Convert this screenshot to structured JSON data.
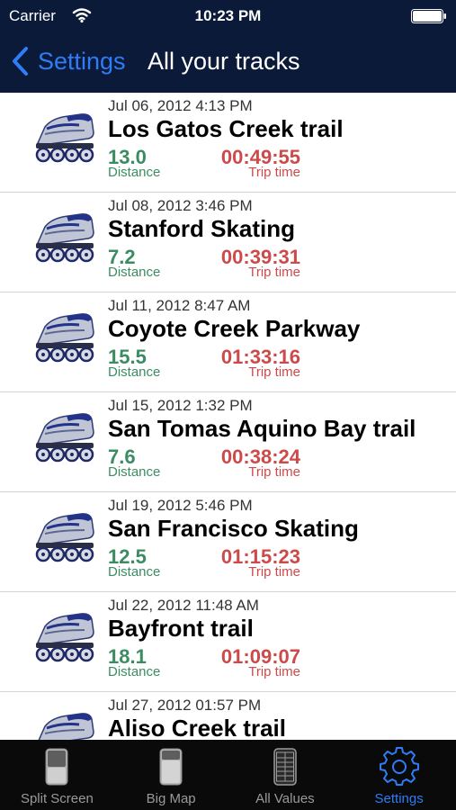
{
  "status_bar": {
    "carrier": "Carrier",
    "time": "10:23 PM"
  },
  "nav": {
    "back_label": "Settings",
    "title": "All your tracks"
  },
  "colors": {
    "nav_background": "#0b1a38",
    "accent": "#2f7cf6",
    "distance": "#3c8c62",
    "trip_time": "#cc4a4a",
    "tab_inactive": "#9a9a9a"
  },
  "tracks": [
    {
      "date": "Jul 06, 2012 4:13 PM",
      "name": "Los Gatos Creek trail",
      "distance": "13.0",
      "distance_label": "Distance",
      "trip_time": "00:49:55",
      "trip_time_label": "Trip time",
      "icon": "inline-skate-icon"
    },
    {
      "date": "Jul 08, 2012 3:46 PM",
      "name": "Stanford Skating",
      "distance": "7.2",
      "distance_label": "Distance",
      "trip_time": "00:39:31",
      "trip_time_label": "Trip time",
      "icon": "inline-skate-icon"
    },
    {
      "date": "Jul 11, 2012 8:47 AM",
      "name": "Coyote Creek Parkway",
      "distance": "15.5",
      "distance_label": "Distance",
      "trip_time": "01:33:16",
      "trip_time_label": "Trip time",
      "icon": "inline-skate-icon"
    },
    {
      "date": "Jul 15, 2012 1:32 PM",
      "name": "San Tomas Aquino Bay trail",
      "distance": "7.6",
      "distance_label": "Distance",
      "trip_time": "00:38:24",
      "trip_time_label": "Trip time",
      "icon": "inline-skate-icon"
    },
    {
      "date": "Jul 19, 2012 5:46 PM",
      "name": "San Francisco Skating",
      "distance": "12.5",
      "distance_label": "Distance",
      "trip_time": "01:15:23",
      "trip_time_label": "Trip time",
      "icon": "inline-skate-icon"
    },
    {
      "date": "Jul 22, 2012 11:48 AM",
      "name": "Bayfront trail",
      "distance": "18.1",
      "distance_label": "Distance",
      "trip_time": "01:09:07",
      "trip_time_label": "Trip time",
      "icon": "inline-skate-icon"
    },
    {
      "date": "Jul 27, 2012 01:57 PM",
      "name": "Aliso Creek trail",
      "distance": "",
      "distance_label": "",
      "trip_time": "",
      "trip_time_label": "",
      "icon": "inline-skate-icon"
    }
  ],
  "tabs": [
    {
      "label": "Split Screen",
      "icon": "split-screen-icon",
      "active": false
    },
    {
      "label": "Big Map",
      "icon": "big-map-icon",
      "active": false
    },
    {
      "label": "All Values",
      "icon": "all-values-icon",
      "active": false
    },
    {
      "label": "Settings",
      "icon": "gear-icon",
      "active": true
    }
  ]
}
